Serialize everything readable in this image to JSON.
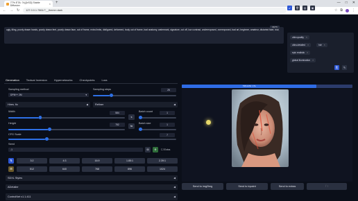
{
  "browser": {
    "tab_title": "77% ETA: 7s] [bSD] Stable Diffusion",
    "url": "127.0.0.1:7861/?__theme=dark",
    "new_tab": "+",
    "win_min": "—",
    "win_max": "□",
    "win_close": "✕"
  },
  "prompt": {
    "negative_text": "ugly, tiling, poorly drawn hands, poorly drawn feet, poorly drawn face, out of frame, extra limbs, disfigured, deformed, body out of frame, bad anatomy, watermark, signature, cut off, low contrast, underexposed, overexposed, bad art, beginner, amateur, distorted face, blur,",
    "counter": "68/75"
  },
  "styles": {
    "chips": [
      "ultra quality",
      "ultra-detailed",
      "hdr",
      "epic realistic",
      "global illumination"
    ]
  },
  "tabs": [
    "Generation",
    "Textual Inversion",
    "Hypernetworks",
    "Checkpoints",
    "Lora"
  ],
  "gen": {
    "sampling_method_label": "Sampling method",
    "sampling_method_value": "DPM++ 2M",
    "sampling_steps_label": "Sampling steps",
    "sampling_steps_value": "25",
    "hires_label": "Hires. fix",
    "refiner_label": "Refiner",
    "width_label": "Width",
    "width_value": "584",
    "height_label": "Height",
    "height_value": "752",
    "batch_count_label": "Batch count",
    "batch_count_value": "1",
    "batch_size_label": "Batch size",
    "batch_size_value": "1",
    "cfg_label": "CFG Scale",
    "cfg_value": "7",
    "seed_label": "Seed",
    "seed_value": "-1",
    "extra_label": "Extra",
    "swap_label": "⇅",
    "ratios_row1": [
      "3:2",
      "4:3",
      "16:9",
      "1.85:1",
      "2.39:1"
    ],
    "ratios_row2": [
      "512",
      "640",
      "768",
      "896",
      "1024"
    ],
    "sdxl_styles": "SDXL Styles",
    "adetailer": "ADetailer",
    "controlnet": "ControlNet v1.1.411"
  },
  "output": {
    "progress_text": "79% ETA: 17s",
    "progress_pct": 79,
    "send_buttons": [
      "Send to img2img",
      "Send to inpaint",
      "Send to extras"
    ]
  },
  "colors": {
    "accent": "#2e70e6",
    "bg": "#0b0f19"
  }
}
